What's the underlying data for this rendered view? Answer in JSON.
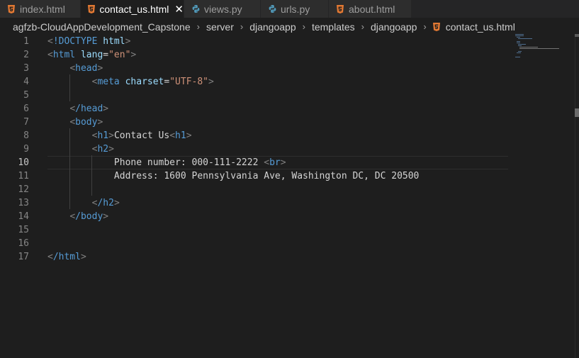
{
  "tabs": [
    {
      "label": "index.html",
      "icon": "html5-icon",
      "active": false
    },
    {
      "label": "contact_us.html",
      "icon": "html5-icon",
      "active": true
    },
    {
      "label": "views.py",
      "icon": "python-icon",
      "active": false
    },
    {
      "label": "urls.py",
      "icon": "python-icon",
      "active": false
    },
    {
      "label": "about.html",
      "icon": "html5-icon",
      "active": false
    }
  ],
  "breadcrumb": [
    "agfzb-CloudAppDevelopment_Capstone",
    "server",
    "djangoapp",
    "templates",
    "djangoapp",
    "contact_us.html"
  ],
  "editor": {
    "current_line": 10,
    "lines": [
      {
        "n": "1",
        "text": "<!DOCTYPE html>"
      },
      {
        "n": "2",
        "text": "<html lang=\"en\">"
      },
      {
        "n": "3",
        "text": "    <head>"
      },
      {
        "n": "4",
        "text": "        <meta charset=\"UTF-8\">"
      },
      {
        "n": "5",
        "text": ""
      },
      {
        "n": "6",
        "text": "    </head>"
      },
      {
        "n": "7",
        "text": "    <body>"
      },
      {
        "n": "8",
        "text": "        <h1>Contact Us<h1>"
      },
      {
        "n": "9",
        "text": "        <h2>"
      },
      {
        "n": "10",
        "text": "            Phone number: 000-111-2222 <br>"
      },
      {
        "n": "11",
        "text": "            Address: 1600 Pennsylvania Ave, Washington DC, DC 20500"
      },
      {
        "n": "12",
        "text": ""
      },
      {
        "n": "13",
        "text": "        </h2>"
      },
      {
        "n": "14",
        "text": "    </body>"
      },
      {
        "n": "15",
        "text": ""
      },
      {
        "n": "16",
        "text": ""
      },
      {
        "n": "17",
        "text": "</html>"
      }
    ]
  },
  "colors": {
    "html_icon": "#e37933",
    "python_icon": "#519aba",
    "tag": "#569cd6",
    "attr": "#9cdcfe",
    "string": "#ce9178"
  }
}
